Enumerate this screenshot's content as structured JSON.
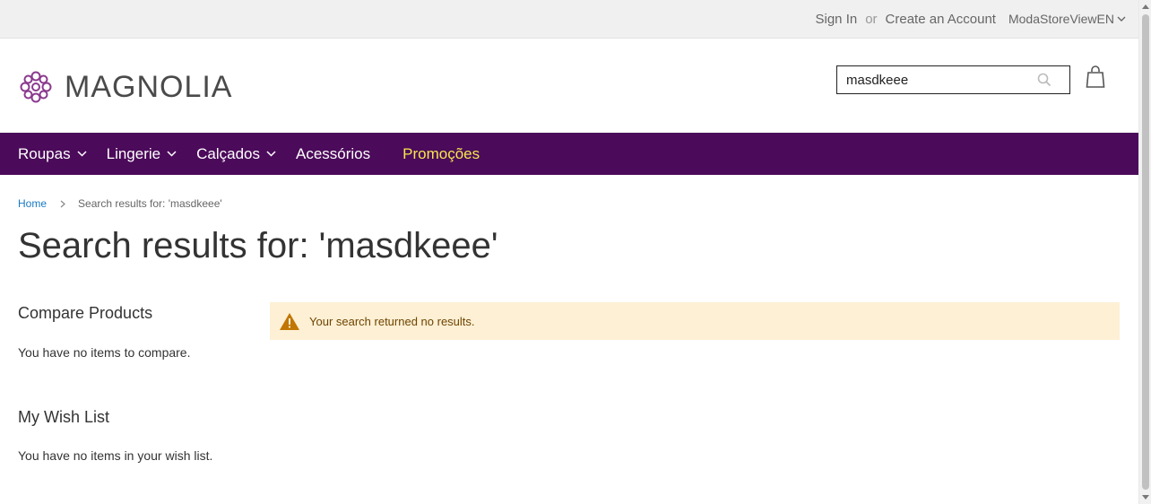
{
  "top_links": {
    "sign_in": "Sign In",
    "or": "or",
    "create_account": "Create an Account",
    "store_view": "ModaStoreViewEN"
  },
  "logo": {
    "text": "MAGNOLIA",
    "color": "#8b3a8f"
  },
  "search": {
    "value": "masdkeee"
  },
  "nav": {
    "items": [
      {
        "label": "Roupas"
      },
      {
        "label": "Lingerie"
      },
      {
        "label": "Calçados"
      },
      {
        "label": "Acessórios"
      },
      {
        "label": "Promoções"
      }
    ],
    "background": "#4b0a5a",
    "promo_color": "#f5e64e"
  },
  "breadcrumb": {
    "home": "Home",
    "current": "Search results for: 'masdkeee'"
  },
  "page_title": "Search results for: 'masdkeee'",
  "sidebar": {
    "compare_title": "Compare Products",
    "compare_text": "You have no items to compare.",
    "wishlist_title": "My Wish List",
    "wishlist_text": "You have no items in your wish list."
  },
  "message": {
    "text": "Your search returned no results.",
    "icon": "warning-icon"
  }
}
